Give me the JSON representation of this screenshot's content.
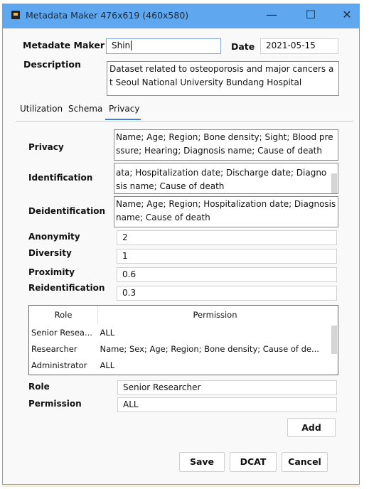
{
  "window": {
    "title": "Metadata Maker 476x619 (460x580)",
    "minimize": "—",
    "maximize": "☐",
    "close": "✕",
    "accent": "#5fa7ef"
  },
  "header": {
    "maker_label": "Metadate Maker",
    "maker_value": "Shin",
    "date_label": "Date",
    "date_value": "2021-05-15",
    "description_label": "Description",
    "description_value": "Dataset related to osteoporosis and major cancers at Seoul National University Bundang Hospital"
  },
  "tabs": [
    {
      "label": "Utilization"
    },
    {
      "label": "Schema"
    },
    {
      "label": "Privacy",
      "active": true
    }
  ],
  "privacy": {
    "privacy_label": "Privacy",
    "privacy_value": "Name;  Age;  Region; Bone density; Sight;  Blood pressure; Hearing; Diagnosis name; Cause of death",
    "identification_label": "Identification",
    "identification_value": "ata; Hospitalization date; Discharge date; Diagnosis name; Cause of death",
    "deidentification_label": "Deidentification",
    "deidentification_value": "Name;  Age;  Region; Hospitalization date; Diagnosis name; Cause of death",
    "anonymity_label": "Anonymity",
    "anonymity_value": "2",
    "diversity_label": "Diversity",
    "diversity_value": "1",
    "proximity_label": "Proximity",
    "proximity_value": "0.6",
    "reidentification_label": "Reidentification",
    "reidentification_value": "0.3"
  },
  "table": {
    "headers": [
      "Role",
      "Permission"
    ],
    "rows": [
      {
        "role": "Senior Resea...",
        "permission": "ALL"
      },
      {
        "role": "Researcher",
        "permission": "Name; Sex; Age; Region; Bone density; Cause of de..."
      },
      {
        "role": "Administrator",
        "permission": "ALL"
      }
    ]
  },
  "form": {
    "role_label": "Role",
    "role_value": "Senior Researcher",
    "permission_label": "Permission",
    "permission_value": "ALL",
    "add": "Add"
  },
  "footer": {
    "save": "Save",
    "dcat": "DCAT",
    "cancel": "Cancel"
  }
}
